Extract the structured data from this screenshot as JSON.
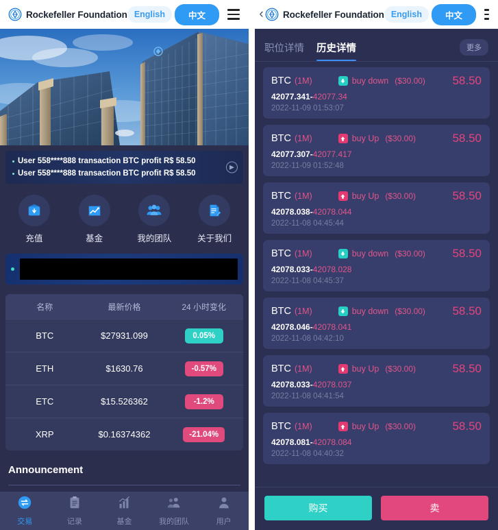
{
  "left": {
    "topbar": {
      "brand_name": "Rockefeller Foundation",
      "lang_en": "English",
      "lang_zh": "中文",
      "logo_icon": "rockefeller-diamond-logo",
      "menu_icon": "hamburger-menu-icon"
    },
    "hero": {
      "alt": "modern-glass-office-buildings-photo"
    },
    "ticker": {
      "lines": [
        "User 558****888 transaction BTC profit R$ 58.50",
        "User 558****888 transaction BTC profit R$ 58.50"
      ],
      "next_icon": "chevron-right-circle-icon"
    },
    "quick_actions": [
      {
        "label": "充值",
        "icon": "wallet-icon"
      },
      {
        "label": "基金",
        "icon": "chart-growth-icon"
      },
      {
        "label": "我的团队",
        "icon": "people-group-icon"
      },
      {
        "label": "关于我们",
        "icon": "document-pencil-icon"
      }
    ],
    "redacted_banner": {
      "label": ""
    },
    "market": {
      "headers": [
        "名称",
        "最新价格",
        "24 小时变化"
      ],
      "rows": [
        {
          "name": "BTC",
          "price": "$27931.099",
          "change": "0.05%",
          "dir": "up"
        },
        {
          "name": "ETH",
          "price": "$1630.76",
          "change": "-0.57%",
          "dir": "down"
        },
        {
          "name": "ETC",
          "price": "$15.526362",
          "change": "-1.2%",
          "dir": "down"
        },
        {
          "name": "XRP",
          "price": "$0.16374362",
          "change": "-21.04%",
          "dir": "down"
        }
      ]
    },
    "announcement": {
      "title": "Announcement"
    },
    "bottom_nav": [
      {
        "label": "交易",
        "icon": "exchange-icon",
        "active": true
      },
      {
        "label": "记录",
        "icon": "clipboard-icon",
        "active": false
      },
      {
        "label": "基金",
        "icon": "bar-chart-icon",
        "active": false
      },
      {
        "label": "我的团队",
        "icon": "people-icon",
        "active": false
      },
      {
        "label": "用户",
        "icon": "user-icon",
        "active": false
      }
    ]
  },
  "right": {
    "topbar": {
      "back_icon": "chevron-left-icon",
      "brand_name": "Rockefeller Foundation",
      "lang_en": "English",
      "lang_zh": "中文",
      "logo_icon": "rockefeller-diamond-logo",
      "menu_icon": "hamburger-menu-icon"
    },
    "tabs": [
      {
        "label": "职位详情",
        "active": false
      },
      {
        "label": "历史详情",
        "active": true
      }
    ],
    "more_badge": "更多",
    "history": [
      {
        "symbol": "BTC",
        "period": "(1M)",
        "direction": "buy down",
        "dir": "down",
        "amount": "($30.00)",
        "profit": "58.50",
        "open": "42077.341-",
        "close": "42077.34",
        "time": "2022-11-09 01:53:07"
      },
      {
        "symbol": "BTC",
        "period": "(1M)",
        "direction": "buy Up",
        "dir": "up",
        "amount": "($30.00)",
        "profit": "58.50",
        "open": "42077.307-",
        "close": "42077.417",
        "time": "2022-11-09 01:52:48"
      },
      {
        "symbol": "BTC",
        "period": "(1M)",
        "direction": "buy Up",
        "dir": "up",
        "amount": "($30.00)",
        "profit": "58.50",
        "open": "42078.038-",
        "close": "42078.044",
        "time": "2022-11-08 04:45:44"
      },
      {
        "symbol": "BTC",
        "period": "(1M)",
        "direction": "buy down",
        "dir": "down",
        "amount": "($30.00)",
        "profit": "58.50",
        "open": "42078.033-",
        "close": "42078.028",
        "time": "2022-11-08 04:45:37"
      },
      {
        "symbol": "BTC",
        "period": "(1M)",
        "direction": "buy down",
        "dir": "down",
        "amount": "($30.00)",
        "profit": "58.50",
        "open": "42078.046-",
        "close": "42078.041",
        "time": "2022-11-08 04:42:10"
      },
      {
        "symbol": "BTC",
        "period": "(1M)",
        "direction": "buy Up",
        "dir": "up",
        "amount": "($30.00)",
        "profit": "58.50",
        "open": "42078.033-",
        "close": "42078.037",
        "time": "2022-11-08 04:41:54"
      },
      {
        "symbol": "BTC",
        "period": "(1M)",
        "direction": "buy Up",
        "dir": "up",
        "amount": "($30.00)",
        "profit": "58.50",
        "open": "42078.081-",
        "close": "42078.084",
        "time": "2022-11-08 04:40:32"
      }
    ],
    "actions": {
      "buy": "购买",
      "sell": "卖"
    }
  },
  "colors": {
    "brand_blue": "#2f9bf5",
    "teal": "#2fd0c5",
    "pink": "#e2487d",
    "panel_bg": "#2b2f52",
    "card_bg": "#383e6b"
  }
}
